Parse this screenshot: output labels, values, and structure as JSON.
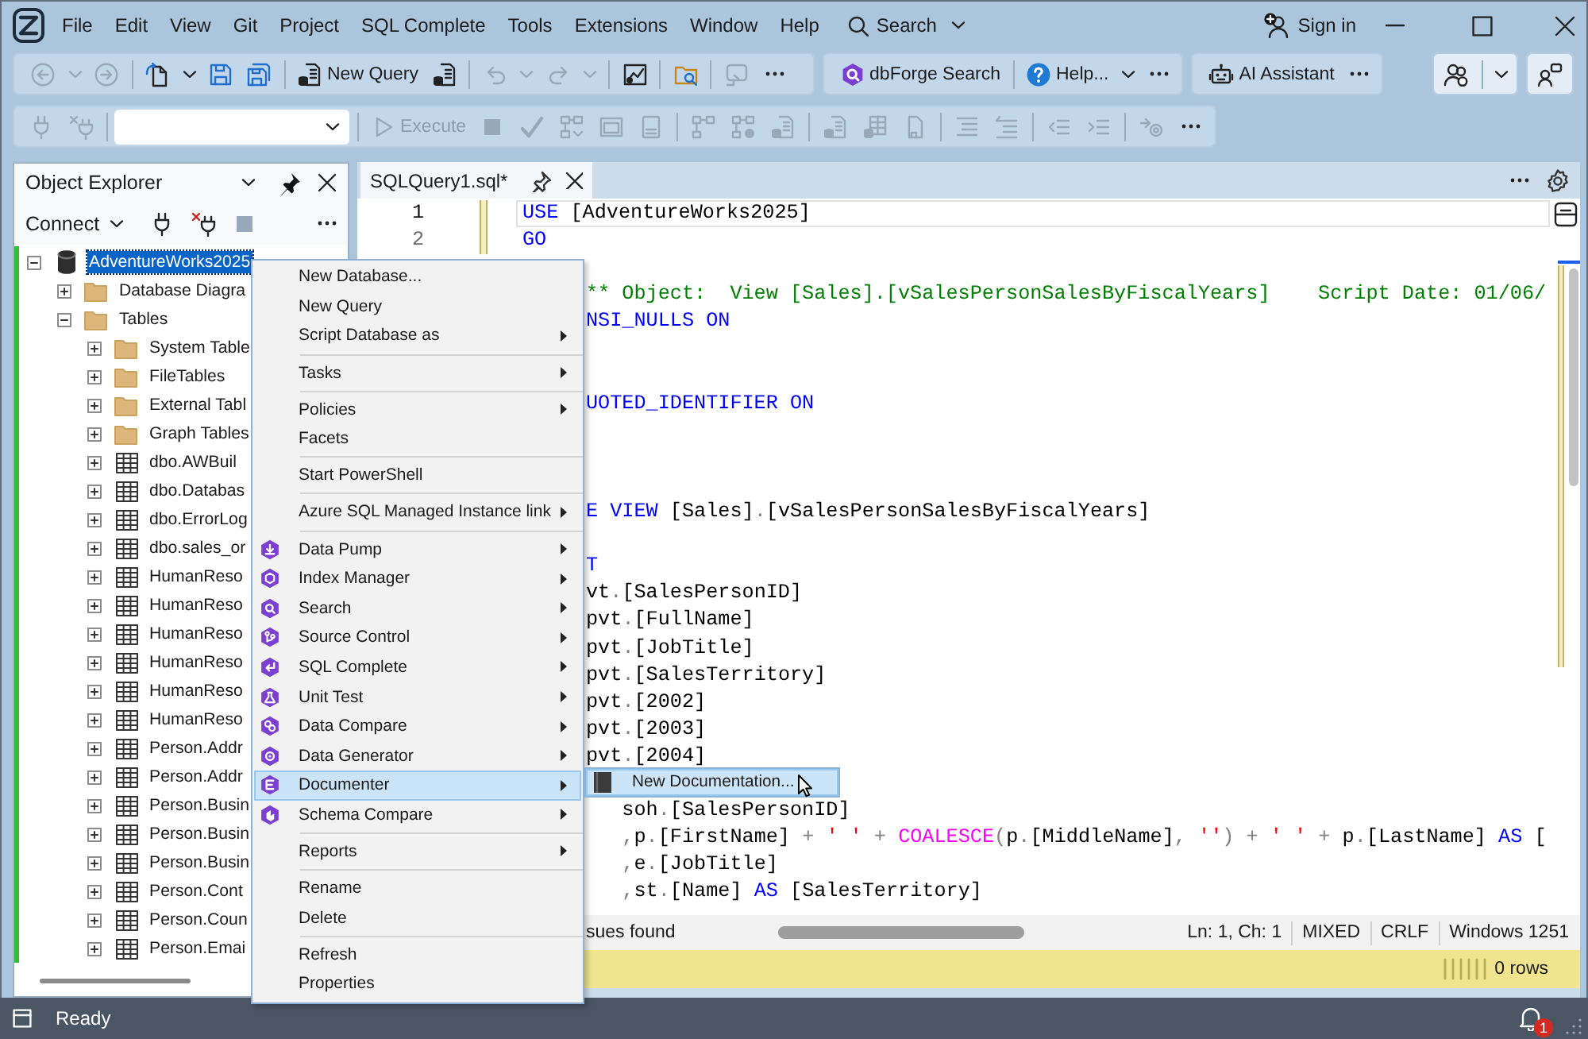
{
  "menu_bar": {
    "items": [
      {
        "label": "File"
      },
      {
        "label": "Edit"
      },
      {
        "label": "View"
      },
      {
        "label": "Git"
      },
      {
        "label": "Project"
      },
      {
        "label": "SQL Complete"
      },
      {
        "label": "Tools"
      },
      {
        "label": "Extensions"
      },
      {
        "label": "Window"
      },
      {
        "label": "Help"
      }
    ],
    "search": {
      "label": "Search"
    },
    "account": {
      "label": "Sign in"
    }
  },
  "toolbar": [
    {
      "groups": [
        [
          {
            "kind": "icon",
            "disabled": true
          },
          {
            "kind": "dropdown",
            "disabled": true
          },
          {
            "kind": "icon",
            "disabled": true
          }
        ],
        [
          {
            "kind": "icon",
            "disabled": false
          },
          {
            "kind": "dropdown",
            "disabled": false
          },
          {
            "kind": "icon",
            "disabled": false
          },
          {
            "kind": "icon",
            "disabled": false
          }
        ],
        [
          {
            "kind": "button",
            "label": "New Query",
            "disabled": false
          },
          {
            "kind": "icon",
            "disabled": false
          }
        ],
        [
          {
            "kind": "icon",
            "disabled": true
          },
          {
            "kind": "dropdown",
            "disabled": true
          },
          {
            "kind": "icon",
            "disabled": true
          },
          {
            "kind": "dropdown",
            "disabled": true
          }
        ],
        [
          {
            "kind": "icon",
            "disabled": false
          }
        ],
        [
          {
            "kind": "icon",
            "disabled": false
          }
        ],
        [
          {
            "kind": "icon",
            "disabled": true
          },
          {
            "kind": "more"
          }
        ]
      ]
    },
    {
      "groups": [
        [
          {
            "kind": "button",
            "label": "dbForge Search",
            "disabled": false
          }
        ],
        [
          {
            "kind": "button",
            "label": "Help...",
            "disabled": false
          },
          {
            "kind": "dropdown",
            "disabled": false
          },
          {
            "kind": "more"
          }
        ]
      ]
    },
    {
      "groups": [
        [
          {
            "kind": "button",
            "label": "AI Assistant",
            "disabled": false
          },
          {
            "kind": "more"
          }
        ]
      ]
    },
    {
      "groups": [
        [
          {
            "kind": "icon",
            "disabled": false
          }
        ],
        [
          {
            "kind": "dropdown",
            "disabled": false
          }
        ]
      ]
    },
    {
      "groups": [
        [
          {
            "kind": "icon",
            "disabled": false
          }
        ]
      ]
    }
  ],
  "query_toolbar": {
    "groups": [
      [
        {
          "kind": "icon",
          "disabled": true
        },
        {
          "kind": "icon",
          "disabled": true
        }
      ],
      [
        {
          "kind": "combo"
        }
      ],
      [
        {
          "kind": "button",
          "label": "Execute",
          "disabled": true
        },
        {
          "kind": "icon",
          "disabled": true
        },
        {
          "kind": "icon",
          "disabled": true
        },
        {
          "kind": "icon",
          "disabled": true
        },
        {
          "kind": "icon",
          "disabled": true
        },
        {
          "kind": "icon",
          "disabled": true
        }
      ],
      [
        {
          "kind": "icon",
          "disabled": true
        },
        {
          "kind": "icon",
          "disabled": true
        },
        {
          "kind": "icon",
          "disabled": true
        }
      ],
      [
        {
          "kind": "icon",
          "disabled": true
        },
        {
          "kind": "icon",
          "disabled": true
        },
        {
          "kind": "icon",
          "disabled": true
        }
      ],
      [
        {
          "kind": "icon",
          "disabled": true
        },
        {
          "kind": "icon",
          "disabled": true
        }
      ],
      [
        {
          "kind": "icon",
          "disabled": true
        },
        {
          "kind": "icon",
          "disabled": true
        }
      ],
      [
        {
          "kind": "icon",
          "disabled": true
        },
        {
          "kind": "more"
        }
      ]
    ]
  },
  "object_explorer": {
    "title": "Object Explorer",
    "connect": {
      "label": "Connect"
    },
    "tools": [
      {
        "kind": "icon",
        "disabled": false
      },
      {
        "kind": "icon",
        "disabled": false
      },
      {
        "kind": "icon",
        "disabled": true
      },
      {
        "kind": "more"
      }
    ],
    "tree": [
      {
        "label": "AdventureWorks2025",
        "kind": "database",
        "expanded": true,
        "selected": true,
        "children": [
          {
            "label": "Database Diagra",
            "kind": "folder",
            "expanded": false,
            "selected": false
          },
          {
            "label": "Tables",
            "kind": "folder",
            "expanded": true,
            "selected": false,
            "children": [
              {
                "label": "System Table",
                "kind": "folder",
                "expanded": false,
                "selected": false
              },
              {
                "label": "FileTables",
                "kind": "folder",
                "expanded": false,
                "selected": false
              },
              {
                "label": "External Tabl",
                "kind": "folder",
                "expanded": false,
                "selected": false
              },
              {
                "label": "Graph Tables",
                "kind": "folder",
                "expanded": false,
                "selected": false
              },
              {
                "label": "dbo.AWBuil",
                "kind": "table",
                "expanded": false,
                "selected": false
              },
              {
                "label": "dbo.Databas",
                "kind": "table",
                "expanded": false,
                "selected": false
              },
              {
                "label": "dbo.ErrorLog",
                "kind": "table",
                "expanded": false,
                "selected": false
              },
              {
                "label": "dbo.sales_or",
                "kind": "table",
                "expanded": false,
                "selected": false
              },
              {
                "label": "HumanReso",
                "kind": "table",
                "expanded": false,
                "selected": false
              },
              {
                "label": "HumanReso",
                "kind": "table",
                "expanded": false,
                "selected": false
              },
              {
                "label": "HumanReso",
                "kind": "table",
                "expanded": false,
                "selected": false
              },
              {
                "label": "HumanReso",
                "kind": "table",
                "expanded": false,
                "selected": false
              },
              {
                "label": "HumanReso",
                "kind": "table",
                "expanded": false,
                "selected": false
              },
              {
                "label": "HumanReso",
                "kind": "table",
                "expanded": false,
                "selected": false
              },
              {
                "label": "Person.Addr",
                "kind": "table",
                "expanded": false,
                "selected": false
              },
              {
                "label": "Person.Addr",
                "kind": "table",
                "expanded": false,
                "selected": false
              },
              {
                "label": "Person.Busin",
                "kind": "table",
                "expanded": false,
                "selected": false
              },
              {
                "label": "Person.Busin",
                "kind": "table",
                "expanded": false,
                "selected": false
              },
              {
                "label": "Person.Busin",
                "kind": "table",
                "expanded": false,
                "selected": false
              },
              {
                "label": "Person.Cont",
                "kind": "table",
                "expanded": false,
                "selected": false
              },
              {
                "label": "Person.Coun",
                "kind": "table",
                "expanded": false,
                "selected": false
              },
              {
                "label": "Person.Emai",
                "kind": "table",
                "expanded": false,
                "selected": false
              }
            ]
          }
        ]
      }
    ]
  },
  "editor": {
    "tabs": [
      {
        "label": "SQLQuery1.sql*",
        "selected": true
      }
    ],
    "lines": [
      {
        "kind": "code",
        "number": "1",
        "current": true,
        "modified": true,
        "covered": false,
        "tokens": [
          {
            "kind": "keyword",
            "text": "USE"
          },
          {
            "kind": "plain",
            "text": " [AdventureWorks2025]"
          }
        ]
      },
      {
        "kind": "code",
        "number": "2",
        "current": false,
        "modified": true,
        "covered": false,
        "tokens": [
          {
            "kind": "keyword",
            "text": "GO"
          }
        ]
      },
      {
        "kind": "blank"
      },
      {
        "kind": "code",
        "covered": true,
        "tokens": [
          {
            "kind": "comment",
            "text": "** Object:  View [Sales].[vSalesPersonSalesByFiscalYears]    Script Date: 01/06/"
          }
        ]
      },
      {
        "kind": "code",
        "covered": true,
        "tokens": [
          {
            "kind": "keyword",
            "text": "NSI_NULLS ON"
          }
        ]
      },
      {
        "kind": "blank"
      },
      {
        "kind": "blank"
      },
      {
        "kind": "code",
        "covered": true,
        "tokens": [
          {
            "kind": "keyword",
            "text": "UOTED_IDENTIFIER ON"
          }
        ]
      },
      {
        "kind": "blank"
      },
      {
        "kind": "blank"
      },
      {
        "kind": "blank"
      },
      {
        "kind": "code",
        "covered": true,
        "tokens": [
          {
            "kind": "keyword",
            "text": "E VIEW"
          },
          {
            "kind": "plain",
            "text": " [Sales]"
          },
          {
            "kind": "operator",
            "text": "."
          },
          {
            "kind": "plain",
            "text": "[vSalesPersonSalesByFiscalYears]"
          }
        ]
      },
      {
        "kind": "blank"
      },
      {
        "kind": "code",
        "covered": true,
        "tokens": [
          {
            "kind": "keyword",
            "text": "T"
          }
        ]
      },
      {
        "kind": "code",
        "covered": true,
        "tokens": [
          {
            "kind": "plain",
            "text": "vt"
          },
          {
            "kind": "operator",
            "text": "."
          },
          {
            "kind": "plain",
            "text": "[SalesPersonID]"
          }
        ]
      },
      {
        "kind": "code",
        "covered": true,
        "tokens": [
          {
            "kind": "plain",
            "text": "pvt"
          },
          {
            "kind": "operator",
            "text": "."
          },
          {
            "kind": "plain",
            "text": "[FullName]"
          }
        ]
      },
      {
        "kind": "code",
        "covered": true,
        "tokens": [
          {
            "kind": "plain",
            "text": "pvt"
          },
          {
            "kind": "operator",
            "text": "."
          },
          {
            "kind": "plain",
            "text": "[JobTitle]"
          }
        ]
      },
      {
        "kind": "code",
        "covered": true,
        "tokens": [
          {
            "kind": "plain",
            "text": "pvt"
          },
          {
            "kind": "operator",
            "text": "."
          },
          {
            "kind": "plain",
            "text": "[SalesTerritory]"
          }
        ]
      },
      {
        "kind": "code",
        "covered": true,
        "tokens": [
          {
            "kind": "plain",
            "text": "pvt"
          },
          {
            "kind": "operator",
            "text": "."
          },
          {
            "kind": "plain",
            "text": "[2002]"
          }
        ]
      },
      {
        "kind": "code",
        "covered": true,
        "tokens": [
          {
            "kind": "plain",
            "text": "pvt"
          },
          {
            "kind": "operator",
            "text": "."
          },
          {
            "kind": "plain",
            "text": "[2003]"
          }
        ]
      },
      {
        "kind": "code",
        "covered": true,
        "tokens": [
          {
            "kind": "plain",
            "text": "pvt"
          },
          {
            "kind": "operator",
            "text": "."
          },
          {
            "kind": "plain",
            "text": "[2004]"
          }
        ]
      },
      {
        "kind": "blank"
      },
      {
        "kind": "code",
        "covered": true,
        "tokens": [
          {
            "kind": "plain",
            "text": "   soh"
          },
          {
            "kind": "operator",
            "text": "."
          },
          {
            "kind": "plain",
            "text": "[SalesPersonID]"
          }
        ]
      },
      {
        "kind": "code",
        "covered": true,
        "tokens": [
          {
            "kind": "operator",
            "text": "   ,"
          },
          {
            "kind": "plain",
            "text": "p"
          },
          {
            "kind": "operator",
            "text": "."
          },
          {
            "kind": "plain",
            "text": "[FirstName] "
          },
          {
            "kind": "operator",
            "text": "+ "
          },
          {
            "kind": "string",
            "text": "' '"
          },
          {
            "kind": "operator",
            "text": " + "
          },
          {
            "kind": "function",
            "text": "COALESCE"
          },
          {
            "kind": "operator",
            "text": "("
          },
          {
            "kind": "plain",
            "text": "p"
          },
          {
            "kind": "operator",
            "text": "."
          },
          {
            "kind": "plain",
            "text": "[MiddleName]"
          },
          {
            "kind": "operator",
            "text": ", "
          },
          {
            "kind": "string",
            "text": "''"
          },
          {
            "kind": "operator",
            "text": ") + "
          },
          {
            "kind": "string",
            "text": "' '"
          },
          {
            "kind": "operator",
            "text": " + "
          },
          {
            "kind": "plain",
            "text": "p"
          },
          {
            "kind": "operator",
            "text": "."
          },
          {
            "kind": "plain",
            "text": "[LastName] "
          },
          {
            "kind": "keyword",
            "text": "AS"
          },
          {
            "kind": "plain",
            "text": " ["
          }
        ]
      },
      {
        "kind": "code",
        "covered": true,
        "tokens": [
          {
            "kind": "operator",
            "text": "   ,"
          },
          {
            "kind": "plain",
            "text": "e"
          },
          {
            "kind": "operator",
            "text": "."
          },
          {
            "kind": "plain",
            "text": "[JobTitle]"
          }
        ]
      },
      {
        "kind": "code",
        "covered": true,
        "tokens": [
          {
            "kind": "operator",
            "text": "   ,"
          },
          {
            "kind": "plain",
            "text": "st"
          },
          {
            "kind": "operator",
            "text": "."
          },
          {
            "kind": "plain",
            "text": "[Name] "
          },
          {
            "kind": "keyword",
            "text": "AS"
          },
          {
            "kind": "plain",
            "text": " [SalesTerritory]"
          }
        ]
      }
    ],
    "issues": "sues found",
    "caret_position": "Ln: 1, Ch: 1",
    "mode": "MIXED",
    "line_ending": "CRLF",
    "encoding": "Windows 1251",
    "results": "0 rows"
  },
  "context_menu": {
    "groups": [
      [
        {
          "label": "New Database...",
          "kind": "plain",
          "submenu": false,
          "selected": false
        },
        {
          "label": "New Query",
          "kind": "plain",
          "submenu": false,
          "selected": false
        },
        {
          "label": "Script Database as",
          "kind": "plain",
          "submenu": true,
          "selected": false
        }
      ],
      [
        {
          "label": "Tasks",
          "kind": "plain",
          "submenu": true,
          "selected": false
        }
      ],
      [
        {
          "label": "Policies",
          "kind": "plain",
          "submenu": true,
          "selected": false
        },
        {
          "label": "Facets",
          "kind": "plain",
          "submenu": false,
          "selected": false
        }
      ],
      [
        {
          "label": "Start PowerShell",
          "kind": "plain",
          "submenu": false,
          "selected": false
        }
      ],
      [
        {
          "label": "Azure SQL Managed Instance link",
          "kind": "plain",
          "submenu": true,
          "selected": false
        }
      ],
      [
        {
          "label": "Data Pump",
          "kind": "tool",
          "submenu": true,
          "selected": false
        },
        {
          "label": "Index Manager",
          "kind": "tool",
          "submenu": true,
          "selected": false
        },
        {
          "label": "Search",
          "kind": "tool",
          "submenu": true,
          "selected": false
        },
        {
          "label": "Source Control",
          "kind": "tool",
          "submenu": true,
          "selected": false
        },
        {
          "label": "SQL Complete",
          "kind": "tool",
          "submenu": true,
          "selected": false
        },
        {
          "label": "Unit Test",
          "kind": "tool",
          "submenu": true,
          "selected": false
        },
        {
          "label": "Data Compare",
          "kind": "tool",
          "submenu": true,
          "selected": false
        },
        {
          "label": "Data Generator",
          "kind": "tool",
          "submenu": true,
          "selected": false
        },
        {
          "label": "Documenter",
          "kind": "tool",
          "submenu": true,
          "selected": true
        },
        {
          "label": "Schema Compare",
          "kind": "tool",
          "submenu": true,
          "selected": false
        }
      ],
      [
        {
          "label": "Reports",
          "kind": "plain",
          "submenu": true,
          "selected": false
        }
      ],
      [
        {
          "label": "Rename",
          "kind": "plain",
          "submenu": false,
          "selected": false
        },
        {
          "label": "Delete",
          "kind": "plain",
          "submenu": false,
          "selected": false
        }
      ],
      [
        {
          "label": "Refresh",
          "kind": "plain",
          "submenu": false,
          "selected": false
        },
        {
          "label": "Properties",
          "kind": "plain",
          "submenu": false,
          "selected": false
        }
      ]
    ]
  },
  "submenu": {
    "items": [
      {
        "label": "New Documentation...",
        "selected": true
      }
    ]
  },
  "status_bar": {
    "text": "Ready",
    "notifications": "1"
  }
}
